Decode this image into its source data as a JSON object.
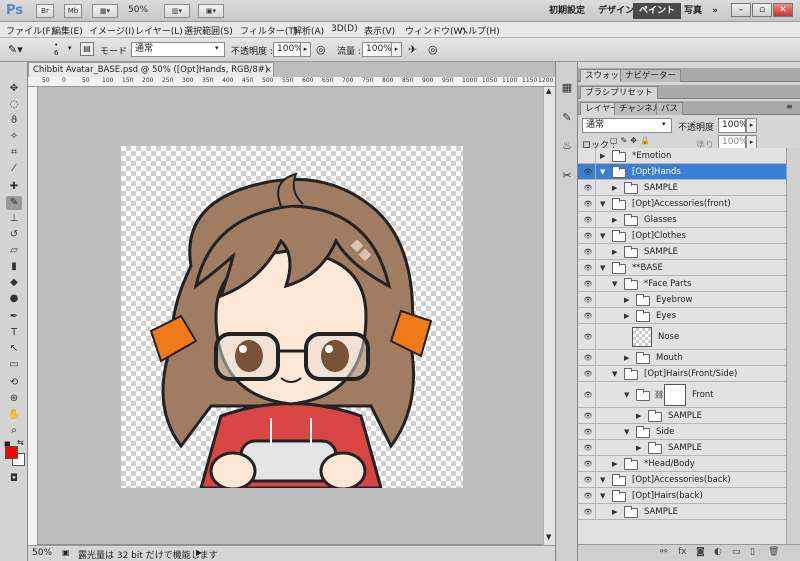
{
  "app": {
    "logo": "Ps",
    "zoom": "50%",
    "workspaces": [
      "初期設定",
      "デザイン",
      "ペイント",
      "写真"
    ],
    "active_workspace": "ペイント",
    "more": "»"
  },
  "menu": [
    "ファイル(F)",
    "編集(E)",
    "イメージ(I)",
    "レイヤー(L)",
    "選択範囲(S)",
    "フィルター(T)",
    "解析(A)",
    "3D(D)",
    "表示(V)",
    "ウィンドウ(W)",
    "ヘルプ(H)"
  ],
  "options": {
    "brush_size": "6",
    "mode_label": "モード :",
    "mode_value": "通常",
    "opacity_label": "不透明度 :",
    "opacity_value": "100%",
    "flow_label": "流量 :",
    "flow_value": "100%"
  },
  "document": {
    "tab_title": "Chibbit Avatar_BASE.psd @ 50% ([Opt]Hands, RGB/8#) *",
    "zoom": "50%",
    "status_message": "露光量は 32 bit だけで機能します",
    "ruler_top": [
      "50",
      "0",
      "50",
      "100",
      "150",
      "200",
      "250",
      "300",
      "350",
      "400",
      "450",
      "500",
      "550",
      "600",
      "650",
      "700",
      "750",
      "800",
      "850",
      "900",
      "950",
      "1000",
      "1050",
      "1100",
      "1150",
      "1200"
    ]
  },
  "panels": {
    "top_tabs": [
      "スウォッチ",
      "ナビゲーター"
    ],
    "brush_preset_tab": "ブラシプリセット",
    "layer_tabs": [
      "レイヤー",
      "チャンネル",
      "パス"
    ],
    "blend_mode": "通常",
    "opacity_label": "不透明度 :",
    "opacity_value": "100%",
    "lock_label": "ロック :",
    "fill_label": "塗り :",
    "fill_value": "100%"
  },
  "layers": [
    {
      "name": "*Emotion",
      "indent": 0,
      "type": "folder",
      "open": false,
      "visible": false,
      "selected": false
    },
    {
      "name": "[Opt]Hands",
      "indent": 0,
      "type": "folder",
      "open": true,
      "visible": true,
      "selected": true
    },
    {
      "name": "SAMPLE",
      "indent": 1,
      "type": "folder",
      "open": false,
      "visible": true,
      "selected": false
    },
    {
      "name": "[Opt]Accessories(front)",
      "indent": 0,
      "type": "folder",
      "open": true,
      "visible": true,
      "selected": false
    },
    {
      "name": "Glasses",
      "indent": 1,
      "type": "folder",
      "open": false,
      "visible": true,
      "selected": false
    },
    {
      "name": "[Opt]Clothes",
      "indent": 0,
      "type": "folder",
      "open": true,
      "visible": true,
      "selected": false
    },
    {
      "name": "SAMPLE",
      "indent": 1,
      "type": "folder",
      "open": false,
      "visible": true,
      "selected": false
    },
    {
      "name": "**BASE",
      "indent": 0,
      "type": "folder",
      "open": true,
      "visible": true,
      "selected": false
    },
    {
      "name": "*Face Parts",
      "indent": 1,
      "type": "folder",
      "open": true,
      "visible": true,
      "selected": false
    },
    {
      "name": "Eyebrow",
      "indent": 2,
      "type": "folder",
      "open": false,
      "visible": true,
      "selected": false
    },
    {
      "name": "Eyes",
      "indent": 2,
      "type": "folder",
      "open": false,
      "visible": true,
      "selected": false
    },
    {
      "name": "Nose",
      "indent": 2,
      "type": "layer",
      "open": false,
      "visible": true,
      "selected": false
    },
    {
      "name": "Mouth",
      "indent": 2,
      "type": "folder",
      "open": false,
      "visible": true,
      "selected": false
    },
    {
      "name": "[Opt]Hairs(Front/Side)",
      "indent": 1,
      "type": "folder",
      "open": true,
      "visible": true,
      "selected": false
    },
    {
      "name": "Front",
      "indent": 2,
      "type": "maskfolder",
      "open": true,
      "visible": true,
      "selected": false
    },
    {
      "name": "SAMPLE",
      "indent": 3,
      "type": "folder",
      "open": false,
      "visible": true,
      "selected": false
    },
    {
      "name": "Side",
      "indent": 2,
      "type": "folder",
      "open": true,
      "visible": true,
      "selected": false
    },
    {
      "name": "SAMPLE",
      "indent": 3,
      "type": "folder",
      "open": false,
      "visible": true,
      "selected": false
    },
    {
      "name": "*Head/Body",
      "indent": 1,
      "type": "folder",
      "open": false,
      "visible": true,
      "selected": false
    },
    {
      "name": "[Opt]Accessories(back)",
      "indent": 0,
      "type": "folder",
      "open": true,
      "visible": true,
      "selected": false
    },
    {
      "name": "[Opt]Hairs(back)",
      "indent": 0,
      "type": "folder",
      "open": true,
      "visible": true,
      "selected": false
    },
    {
      "name": "SAMPLE",
      "indent": 1,
      "type": "folder",
      "open": false,
      "visible": true,
      "selected": false
    }
  ],
  "colors": {
    "accent": "#3a7fd5",
    "foreground": "#ff0000",
    "background": "#ffffff",
    "hair": "#a07d62",
    "ribbon": "#f07a1a",
    "hoodie": "#d84545"
  }
}
